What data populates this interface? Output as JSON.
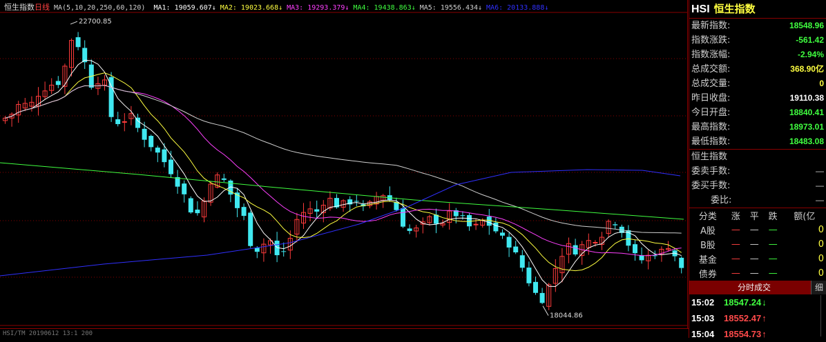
{
  "header": {
    "instrument_name": "恒生指数",
    "period": "日线",
    "ma_params": "MA(5,10,20,250,60,120)",
    "ma": [
      {
        "label": "MA1: 19059.607↓",
        "color": "#ffffff"
      },
      {
        "label": "MA2: 19023.668↓",
        "color": "#ffff40"
      },
      {
        "label": "MA3: 19293.379↓",
        "color": "#ff40ff"
      },
      {
        "label": "MA4: 19438.863↓",
        "color": "#40ff40"
      },
      {
        "label": "MA5: 19556.434↓",
        "color": "#cfcfcf"
      },
      {
        "label": "MA6: 20133.888↓",
        "color": "#3030ff"
      }
    ]
  },
  "annotations": {
    "high": "22700.85",
    "low": "18044.86"
  },
  "bottom_strip": "HSI/TM 20190612 13:1 200",
  "chart_data": {
    "type": "candlestick",
    "colors": {
      "up": "#ff3b3b",
      "down": "#40e8f0",
      "bg": "#000000",
      "grid": "#8b0000"
    },
    "highest": 22700.85,
    "lowest": 18044.86,
    "moving_averages": [
      {
        "name": "MA1",
        "color": "#ffffff"
      },
      {
        "name": "MA2",
        "color": "#ffff40"
      },
      {
        "name": "MA3",
        "color": "#ff40ff"
      },
      {
        "name": "MA4",
        "color": "#40ff40"
      },
      {
        "name": "MA5",
        "color": "#cfcfcf"
      },
      {
        "name": "MA6",
        "color": "#3030ff"
      }
    ]
  },
  "panel": {
    "code": "HSI",
    "name": "恒生指数",
    "quotes": [
      {
        "label": "最新指数:",
        "value": "18548.96",
        "color": "#40ff40"
      },
      {
        "label": "指数涨跌:",
        "value": "-561.42",
        "color": "#40ff40"
      },
      {
        "label": "指数涨幅:",
        "value": "-2.94%",
        "color": "#40ff40"
      },
      {
        "label": "总成交额:",
        "value": "368.90亿",
        "color": "#ffff40"
      },
      {
        "label": "总成交量:",
        "value": "0",
        "color": "#ffff40"
      },
      {
        "label": "昨日收盘:",
        "value": "19110.38",
        "color": "#ffffff"
      },
      {
        "label": "今日开盘:",
        "value": "18840.41",
        "color": "#40ff40"
      },
      {
        "label": "最高指数:",
        "value": "18973.01",
        "color": "#40ff40"
      },
      {
        "label": "最低指数:",
        "value": "18483.08",
        "color": "#40ff40"
      }
    ],
    "section2_title": "恒生指数",
    "section2": [
      {
        "label": "委卖手数:",
        "value": "—"
      },
      {
        "label": "委买手数:",
        "value": "—"
      },
      {
        "label": "委比:",
        "value": "—"
      }
    ],
    "categories": {
      "headers": [
        "分类",
        "涨",
        "平",
        "跌",
        "额(亿"
      ],
      "rows": [
        {
          "name": "A股",
          "up": "—",
          "flat": "—",
          "down": "—",
          "amount": "0"
        },
        {
          "name": "B股",
          "up": "—",
          "flat": "—",
          "down": "—",
          "amount": "0"
        },
        {
          "name": "基金",
          "up": "—",
          "flat": "—",
          "down": "—",
          "amount": "0"
        },
        {
          "name": "债券",
          "up": "—",
          "flat": "—",
          "down": "—",
          "amount": "0"
        }
      ]
    },
    "ticks_header": "分时成交",
    "ticks_button": "细",
    "ticks": [
      {
        "time": "15:02",
        "price": "18547.24",
        "dir": "down"
      },
      {
        "time": "15:03",
        "price": "18552.47",
        "dir": "up"
      },
      {
        "time": "15:04",
        "price": "18554.73",
        "dir": "up"
      }
    ]
  }
}
